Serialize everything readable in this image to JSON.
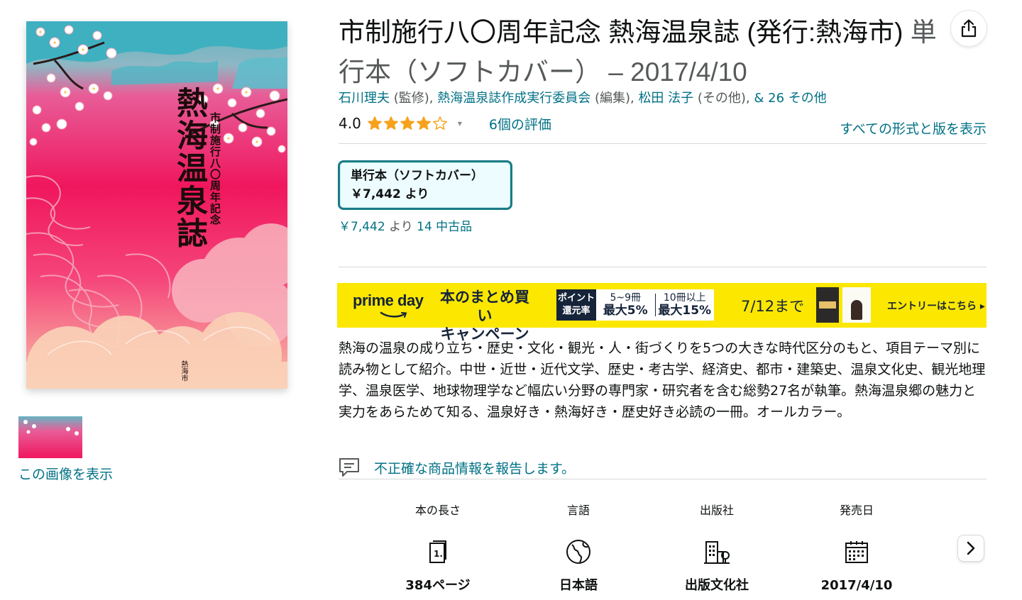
{
  "product": {
    "title": "市制施行八〇周年記念 熱海温泉誌 (発行:熱海市)",
    "format": "単行本（ソフトカバー）",
    "date": "– 2017/4/10"
  },
  "cover": {
    "title": "熱海温泉誌",
    "subtitle": "市制施行八〇周年記念",
    "publisher_mark": "熱海市"
  },
  "media": {
    "view_image": "この画像を表示"
  },
  "byline": {
    "author1": "石川理夫",
    "role1": " (監修), ",
    "author2": "熱海温泉誌作成実行委員会",
    "role2": " (編集), ",
    "author3": "松田 法子",
    "role3": " (その他), ",
    "more": "& 26 その他"
  },
  "rating": {
    "value": "4.0",
    "stars": 4,
    "reviews": "6個の評価",
    "all_formats": "すべての形式と版を表示"
  },
  "format_card": {
    "name": "単行本（ソフトカバー）",
    "price": "￥7,442 より"
  },
  "used": {
    "price": "￥7,442",
    "from": " より ",
    "count": "14 中古品"
  },
  "banner": {
    "brand": "prime day",
    "headline_1": "本のまとめ買い",
    "headline_2": "キャンペーン",
    "badge_1": "ポイント",
    "badge_2": "還元率",
    "tier1_top": "5~9冊",
    "tier1_bottom": "最大5%",
    "tier2_top": "10冊以上",
    "tier2_bottom": "最大15%",
    "deadline": "7/12まで",
    "entry": "エントリーはこちら ▸"
  },
  "description": "熱海の温泉の成り立ち・歴史・文化・観光・人・街づくりを5つの大きな時代区分のもと、項目テーマ別に読み物として紹介。中世・近世・近代文学、歴史・考古学、経済史、都市・建築史、温泉文化史、観光地理学、温泉医学、地球物理学など幅広い分野の専門家・研究者を含む総勢27名が執筆。熱海温泉郷の魅力と実力をあらためて知る、温泉好き・熱海好き・歴史好き必読の一冊。オールカラー。",
  "report": "不正確な商品情報を報告します。",
  "details": [
    {
      "label": "本の長さ",
      "value": "384ページ",
      "icon": "page-icon"
    },
    {
      "label": "言語",
      "value": "日本語",
      "icon": "globe-icon"
    },
    {
      "label": "出版社",
      "value": "出版文化社",
      "icon": "building-icon"
    },
    {
      "label": "発売日",
      "value": "2017/4/10",
      "icon": "calendar-icon"
    }
  ],
  "colors": {
    "link": "#007185",
    "star": "#f7a21d",
    "banner": "#fce700",
    "format_border": "#1a7b86"
  }
}
